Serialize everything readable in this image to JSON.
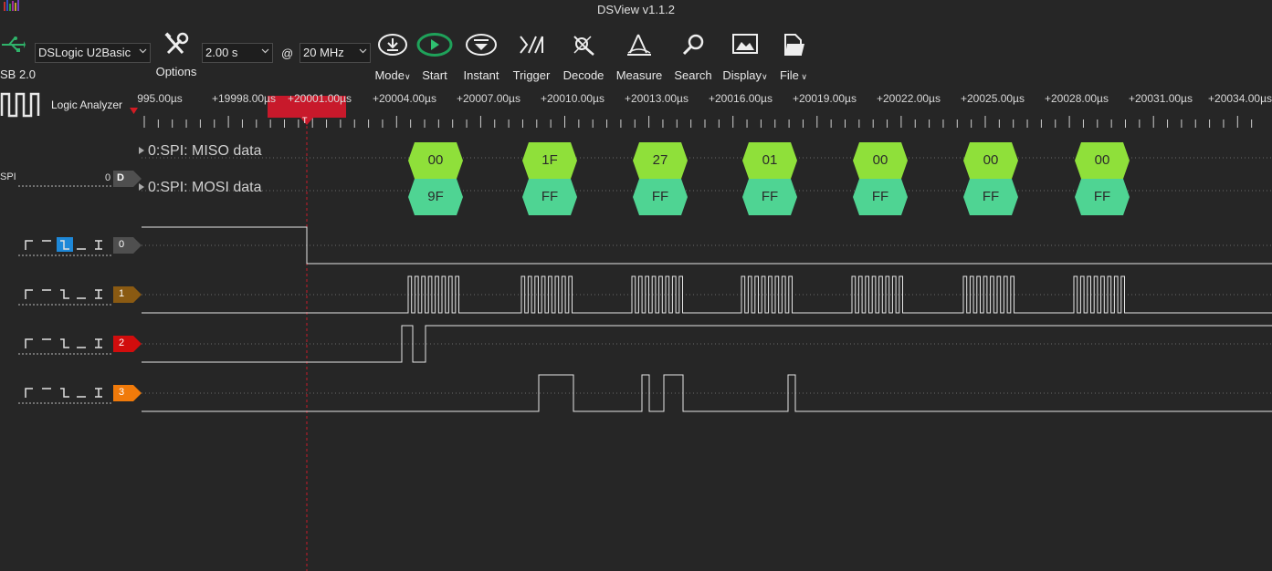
{
  "app": {
    "title": "DSView v1.1.2",
    "usb_label": "SB 2.0"
  },
  "toolbar": {
    "device": "DSLogic U2Basic",
    "options_label": "Options",
    "duration": "2.00 s",
    "at": "@",
    "samplerate": "20 MHz",
    "buttons": {
      "mode": "Mode",
      "start": "Start",
      "instant": "Instant",
      "trigger": "Trigger",
      "decode": "Decode",
      "measure": "Measure",
      "search": "Search",
      "display": "Display",
      "file": "File"
    }
  },
  "mode_label": "Logic Analyzer",
  "ruler": {
    "labels": [
      "995.00µs",
      "+19998.00µs",
      "+20001.00µs",
      "+20004.00µs",
      "+20007.00µs",
      "+20010.00µs",
      "+20013.00µs",
      "+20016.00µs",
      "+20019.00µs",
      "+20022.00µs",
      "+20025.00µs",
      "+20028.00µs",
      "+20031.00µs",
      "+20034.00µs"
    ],
    "cursor_marker": "T"
  },
  "decoder": {
    "name": "SPI",
    "index": "0",
    "badge": "D",
    "rows": [
      {
        "label": "0:SPI: MISO data",
        "values": [
          "00",
          "1F",
          "27",
          "01",
          "00",
          "00",
          "00"
        ]
      },
      {
        "label": "0:SPI: MOSI data",
        "values": [
          "9F",
          "FF",
          "FF",
          "FF",
          "FF",
          "FF",
          "FF"
        ]
      }
    ]
  },
  "channels": [
    {
      "id": "0",
      "color": "#4f4f4f"
    },
    {
      "id": "1",
      "color": "#8a5a12"
    },
    {
      "id": "2",
      "color": "#d10d0d"
    },
    {
      "id": "3",
      "color": "#f07a0a"
    }
  ],
  "colors": {
    "miso": "#8fe03a",
    "mosi": "#4fd493",
    "trigger": "#c8192b",
    "accent": "#1e88d8"
  }
}
